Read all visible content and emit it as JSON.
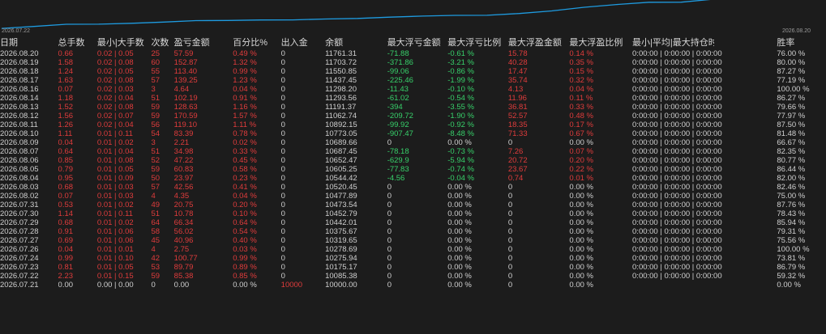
{
  "chart": {
    "start_label": "2026.07.22",
    "end_label": "2026.08.20",
    "line_color": "#1e9be0",
    "balance_series": [
      10085.38,
      10175.17,
      10275.94,
      10278.69,
      10319.65,
      10375.67,
      10442.01,
      10452.79,
      10473.54,
      10477.89,
      10520.45,
      10544.42,
      10605.25,
      10652.47,
      10687.45,
      10689.66,
      10773.05,
      10892.15,
      11062.74,
      11191.37,
      11293.56,
      11298.2,
      11437.45,
      11550.85,
      11703.72,
      11761.31
    ]
  },
  "colors": {
    "bg": "#1c1c1c",
    "red": "#e03c3c",
    "green": "#37d06a",
    "text": "#d0d0d0"
  },
  "table": {
    "headers": [
      "日期",
      "总手数",
      "最小|大手数",
      "次数",
      "盈亏金额",
      "百分比%",
      "出入金",
      "余额",
      "最大浮亏金额",
      "最大浮亏比例",
      "最大浮盈金额",
      "最大浮盈比例",
      "最小|平均|最大持仓时间",
      "",
      "胜率"
    ],
    "rows": [
      [
        "2026.08.20",
        "0.66",
        "0.02 | 0.05",
        "25",
        "57.59",
        "0.49 %",
        "0",
        "11761.31",
        "-71.88",
        "-0.61 %",
        "15.78",
        "0.14 %",
        "0:00:00 | 0:00:00 | 0:00:00",
        "76.00 %"
      ],
      [
        "2026.08.19",
        "1.58",
        "0.02 | 0.08",
        "60",
        "152.87",
        "1.32 %",
        "0",
        "11703.72",
        "-371.86",
        "-3.21 %",
        "40.28",
        "0.35 %",
        "0:00:00 | 0:00:00 | 0:00:00",
        "80.00 %"
      ],
      [
        "2026.08.18",
        "1.24",
        "0.02 | 0.05",
        "55",
        "113.40",
        "0.99 %",
        "0",
        "11550.85",
        "-99.06",
        "-0.86 %",
        "17.47",
        "0.15 %",
        "0:00:00 | 0:00:00 | 0:00:00",
        "87.27 %"
      ],
      [
        "2026.08.17",
        "1.63",
        "0.02 | 0.08",
        "57",
        "139.25",
        "1.23 %",
        "0",
        "11437.45",
        "-225.46",
        "-1.99 %",
        "35.74",
        "0.32 %",
        "0:00:00 | 0:00:00 | 0:00:00",
        "77.19 %"
      ],
      [
        "2026.08.16",
        "0.07",
        "0.02 | 0.03",
        "3",
        "4.64",
        "0.04 %",
        "0",
        "11298.20",
        "-11.43",
        "-0.10 %",
        "4.13",
        "0.04 %",
        "0:00:00 | 0:00:00 | 0:00:00",
        "100.00 %"
      ],
      [
        "2026.08.14",
        "1.18",
        "0.02 | 0.04",
        "51",
        "102.19",
        "0.91 %",
        "0",
        "11293.56",
        "-61.02",
        "-0.54 %",
        "11.96",
        "0.11 %",
        "0:00:00 | 0:00:00 | 0:00:00",
        "86.27 %"
      ],
      [
        "2026.08.13",
        "1.52",
        "0.02 | 0.08",
        "59",
        "128.63",
        "1.16 %",
        "0",
        "11191.37",
        "-394",
        "-3.55 %",
        "36.81",
        "0.33 %",
        "0:00:00 | 0:00:00 | 0:00:00",
        "79.66 %"
      ],
      [
        "2026.08.12",
        "1.56",
        "0.02 | 0.07",
        "59",
        "170.59",
        "1.57 %",
        "0",
        "11062.74",
        "-209.72",
        "-1.90 %",
        "52.57",
        "0.48 %",
        "0:00:00 | 0:00:00 | 0:00:00",
        "77.97 %"
      ],
      [
        "2026.08.11",
        "1.26",
        "0.02 | 0.04",
        "56",
        "119.10",
        "1.11 %",
        "0",
        "10892.15",
        "-99.92",
        "-0.92 %",
        "18.35",
        "0.17 %",
        "0:00:00 | 0:00:00 | 0:00:00",
        "87.50 %"
      ],
      [
        "2026.08.10",
        "1.11",
        "0.01 | 0.11",
        "54",
        "83.39",
        "0.78 %",
        "0",
        "10773.05",
        "-907.47",
        "-8.48 %",
        "71.33",
        "0.67 %",
        "0:00:00 | 0:00:00 | 0:00:00",
        "81.48 %"
      ],
      [
        "2026.08.09",
        "0.04",
        "0.01 | 0.02",
        "3",
        "2.21",
        "0.02 %",
        "0",
        "10689.66",
        "0",
        "0.00 %",
        "0",
        "0.00 %",
        "0:00:00 | 0:00:00 | 0:00:00",
        "66.67 %"
      ],
      [
        "2026.08.07",
        "0.64",
        "0.01 | 0.04",
        "51",
        "34.98",
        "0.33 %",
        "0",
        "10687.45",
        "-78.18",
        "-0.73 %",
        "7.26",
        "0.07 %",
        "0:00:00 | 0:00:00 | 0:00:00",
        "82.35 %"
      ],
      [
        "2026.08.06",
        "0.85",
        "0.01 | 0.08",
        "52",
        "47.22",
        "0.45 %",
        "0",
        "10652.47",
        "-629.9",
        "-5.94 %",
        "20.72",
        "0.20 %",
        "0:00:00 | 0:00:00 | 0:00:00",
        "80.77 %"
      ],
      [
        "2026.08.05",
        "0.79",
        "0.01 | 0.05",
        "59",
        "60.83",
        "0.58 %",
        "0",
        "10605.25",
        "-77.83",
        "-0.74 %",
        "23.67",
        "0.22 %",
        "0:00:00 | 0:00:00 | 0:00:00",
        "86.44 %"
      ],
      [
        "2026.08.04",
        "0.95",
        "0.01 | 0.09",
        "50",
        "23.97",
        "0.23 %",
        "0",
        "10544.42",
        "-4.56",
        "-0.04 %",
        "0.74",
        "0.01 %",
        "0:00:00 | 0:00:00 | 0:00:00",
        "82.00 %"
      ],
      [
        "2026.08.03",
        "0.68",
        "0.01 | 0.03",
        "57",
        "42.56",
        "0.41 %",
        "0",
        "10520.45",
        "0",
        "0.00 %",
        "0",
        "0.00 %",
        "0:00:00 | 0:00:00 | 0:00:00",
        "82.46 %"
      ],
      [
        "2026.08.02",
        "0.07",
        "0.01 | 0.03",
        "4",
        "4.35",
        "0.04 %",
        "0",
        "10477.89",
        "0",
        "0.00 %",
        "0",
        "0.00 %",
        "0:00:00 | 0:00:00 | 0:00:00",
        "75.00 %"
      ],
      [
        "2026.07.31",
        "0.53",
        "0.01 | 0.02",
        "49",
        "20.75",
        "0.20 %",
        "0",
        "10473.54",
        "0",
        "0.00 %",
        "0",
        "0.00 %",
        "0:00:00 | 0:00:00 | 0:00:00",
        "87.76 %"
      ],
      [
        "2026.07.30",
        "1.14",
        "0.01 | 0.11",
        "51",
        "10.78",
        "0.10 %",
        "0",
        "10452.79",
        "0",
        "0.00 %",
        "0",
        "0.00 %",
        "0:00:00 | 0:00:00 | 0:00:00",
        "78.43 %"
      ],
      [
        "2026.07.29",
        "0.68",
        "0.01 | 0.02",
        "64",
        "66.34",
        "0.64 %",
        "0",
        "10442.01",
        "0",
        "0.00 %",
        "0",
        "0.00 %",
        "0:00:00 | 0:00:00 | 0:00:00",
        "85.94 %"
      ],
      [
        "2026.07.28",
        "0.91",
        "0.01 | 0.06",
        "58",
        "56.02",
        "0.54 %",
        "0",
        "10375.67",
        "0",
        "0.00 %",
        "0",
        "0.00 %",
        "0:00:00 | 0:00:00 | 0:00:00",
        "79.31 %"
      ],
      [
        "2026.07.27",
        "0.69",
        "0.01 | 0.06",
        "45",
        "40.96",
        "0.40 %",
        "0",
        "10319.65",
        "0",
        "0.00 %",
        "0",
        "0.00 %",
        "0:00:00 | 0:00:00 | 0:00:00",
        "75.56 %"
      ],
      [
        "2026.07.26",
        "0.04",
        "0.01 | 0.01",
        "4",
        "2.75",
        "0.03 %",
        "0",
        "10278.69",
        "0",
        "0.00 %",
        "0",
        "0.00 %",
        "0:00:00 | 0:00:00 | 0:00:00",
        "100.00 %"
      ],
      [
        "2026.07.24",
        "0.99",
        "0.01 | 0.10",
        "42",
        "100.77",
        "0.99 %",
        "0",
        "10275.94",
        "0",
        "0.00 %",
        "0",
        "0.00 %",
        "0:00:00 | 0:00:00 | 0:00:00",
        "73.81 %"
      ],
      [
        "2026.07.23",
        "0.81",
        "0.01 | 0.05",
        "53",
        "89.79",
        "0.89 %",
        "0",
        "10175.17",
        "0",
        "0.00 %",
        "0",
        "0.00 %",
        "0:00:00 | 0:00:00 | 0:00:00",
        "86.79 %"
      ],
      [
        "2026.07.22",
        "2.23",
        "0.01 | 0.15",
        "59",
        "85.38",
        "0.85 %",
        "0",
        "10085.38",
        "0",
        "0.00 %",
        "0",
        "0.00 %",
        "0:00:00 | 0:00:00 | 0:00:00",
        "59.32 %"
      ],
      [
        "2026.07.21",
        "0.00",
        "0.00 | 0.00",
        "0",
        "0.00",
        "0.00 %",
        "10000",
        "10000.00",
        "0",
        "0.00 %",
        "0",
        "0.00 %",
        "",
        "0.00 %"
      ]
    ]
  }
}
